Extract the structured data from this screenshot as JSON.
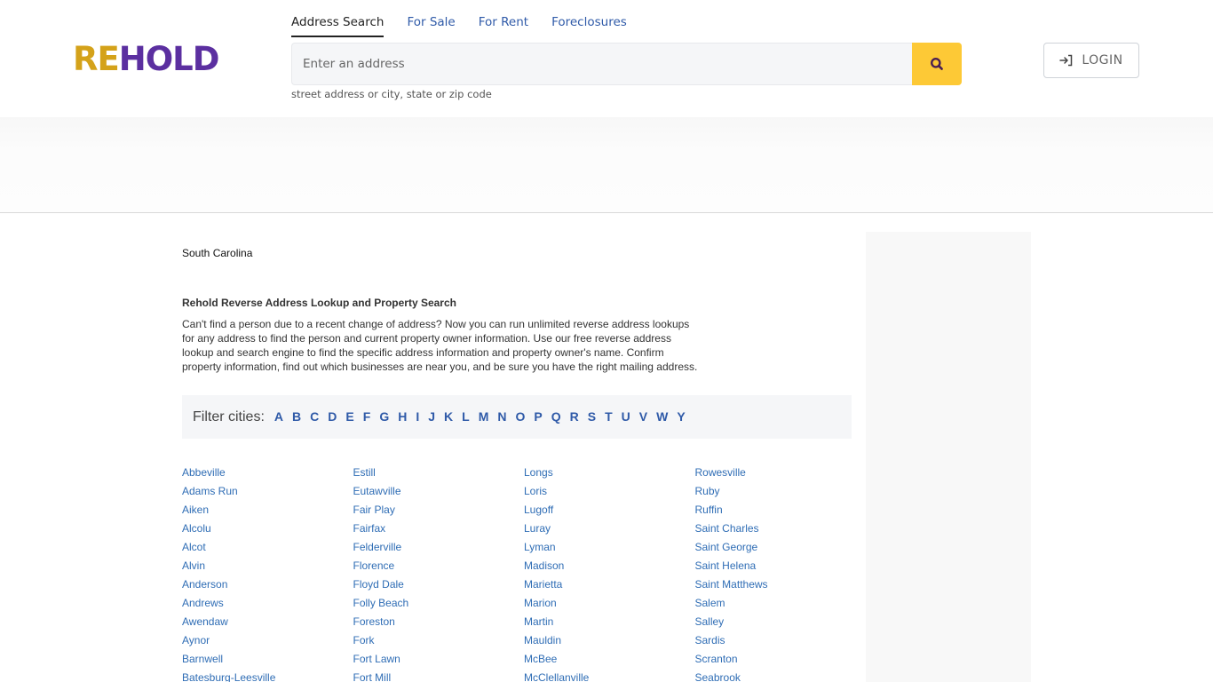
{
  "header": {
    "logo": {
      "part1": "RE",
      "part2": "HOLD"
    },
    "tabs": [
      {
        "label": "Address Search",
        "active": true
      },
      {
        "label": "For Sale",
        "active": false
      },
      {
        "label": "For Rent",
        "active": false
      },
      {
        "label": "Foreclosures",
        "active": false
      }
    ],
    "search": {
      "placeholder": "Enter an address",
      "value": "",
      "hint": "street address or city, state or zip code",
      "icon": "search-icon"
    },
    "login": {
      "label": "LOGIN",
      "icon": "login-icon"
    }
  },
  "main": {
    "state": "South Carolina",
    "section_title": "Rehold Reverse Address Lookup and Property Search",
    "description": "Can't find a person due to a recent change of address? Now you can run unlimited reverse address lookups for any address to find the person and current property owner information. Use our free reverse address lookup and search engine to find the specific address information and property owner's name. Confirm property information, find out which businesses are near you, and be sure you have the right mailing address.",
    "filter": {
      "label": "Filter cities:",
      "letters": [
        "A",
        "B",
        "C",
        "D",
        "E",
        "F",
        "G",
        "H",
        "I",
        "J",
        "K",
        "L",
        "M",
        "N",
        "O",
        "P",
        "Q",
        "R",
        "S",
        "T",
        "U",
        "V",
        "W",
        "Y"
      ]
    },
    "cities": [
      [
        "Abbeville",
        "Adams Run",
        "Aiken",
        "Alcolu",
        "Alcot",
        "Alvin",
        "Anderson",
        "Andrews",
        "Awendaw",
        "Aynor",
        "Barnwell",
        "Batesburg-Leesville"
      ],
      [
        "Estill",
        "Eutawville",
        "Fair Play",
        "Fairfax",
        "Felderville",
        "Florence",
        "Floyd Dale",
        "Folly Beach",
        "Foreston",
        "Fork",
        "Fort Lawn",
        "Fort Mill"
      ],
      [
        "Longs",
        "Loris",
        "Lugoff",
        "Luray",
        "Lyman",
        "Madison",
        "Marietta",
        "Marion",
        "Martin",
        "Mauldin",
        "McBee",
        "McClellanville"
      ],
      [
        "Rowesville",
        "Ruby",
        "Ruffin",
        "Saint Charles",
        "Saint George",
        "Saint Helena",
        "Saint Matthews",
        "Salem",
        "Salley",
        "Sardis",
        "Scranton",
        "Seabrook"
      ]
    ]
  },
  "colors": {
    "brand_gold": "#d4a21a",
    "brand_purple": "#5b2fa0",
    "search_button": "#fdc936",
    "link_blue": "#2f6db5",
    "tab_blue": "#2f5aa8"
  }
}
